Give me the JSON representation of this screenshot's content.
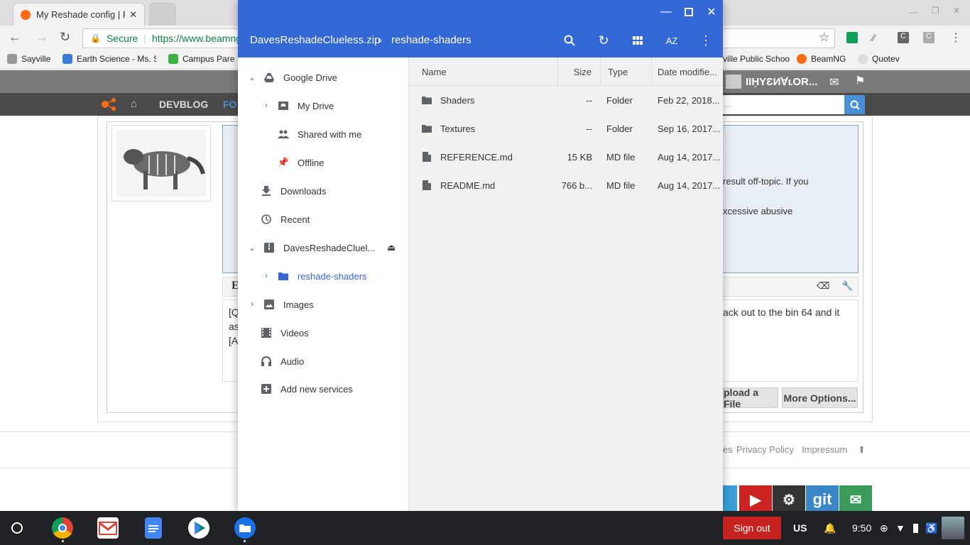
{
  "browser": {
    "tab_title": "My Reshade config | Pag",
    "secure_label": "Secure",
    "url": "https://www.beamng",
    "bookmarks": [
      "Sayville",
      "Earth Science - Ms. S",
      "Campus Pare",
      "ville Public Schoo",
      "BeamNG",
      "Quotev"
    ]
  },
  "website": {
    "nav_devblog": "DEVBLOG",
    "nav_forum_partial": "FO",
    "username": "IIḤYƐИ∀ʟOR...",
    "post_text_1": "result off-topic. If you",
    "post_text_2": "xcessive abusive",
    "reply_text_1": "ack out to the bin 64 and it",
    "reply_left_1": "[Q",
    "reply_left_2": "as",
    "reply_left_3": "[A",
    "reply_left_header": "E",
    "upload_label": "pload a File",
    "more_options": "More Options...",
    "footer_partial": "es",
    "footer_privacy": "Privacy Policy",
    "footer_impressum": "Impressum",
    "social_git": "git"
  },
  "dialog": {
    "breadcrumb": [
      "DavesReshadeClueless.zip",
      "reshade-shaders"
    ],
    "nav": [
      {
        "label": "Google Drive",
        "icon": "google-drive-icon",
        "expanded": true
      },
      {
        "label": "My Drive",
        "icon": "my-drive-icon"
      },
      {
        "label": "Shared with me",
        "icon": "shared-icon"
      },
      {
        "label": "Offline",
        "icon": "pin-icon"
      },
      {
        "label": "Downloads",
        "icon": "download-icon"
      },
      {
        "label": "Recent",
        "icon": "clock-icon"
      },
      {
        "label": "DavesReshadeCluel...",
        "icon": "archive-icon"
      },
      {
        "label": "reshade-shaders",
        "icon": "folder-icon",
        "selected": true
      },
      {
        "label": "Images",
        "icon": "image-icon"
      },
      {
        "label": "Videos",
        "icon": "video-icon"
      },
      {
        "label": "Audio",
        "icon": "audio-icon"
      },
      {
        "label": "Add new services",
        "icon": "add-icon"
      }
    ],
    "columns": {
      "name": "Name",
      "size": "Size",
      "type": "Type",
      "date": "Date modifie..."
    },
    "files": [
      {
        "name": "Shaders",
        "size": "--",
        "type": "Folder",
        "date": "Feb 22, 2018...",
        "icon": "folder-icon"
      },
      {
        "name": "Textures",
        "size": "--",
        "type": "Folder",
        "date": "Sep 16, 2017...",
        "icon": "folder-icon"
      },
      {
        "name": "REFERENCE.md",
        "size": "15 KB",
        "type": "MD file",
        "date": "Aug 14, 2017...",
        "icon": "file-icon"
      },
      {
        "name": "README.md",
        "size": "766 b...",
        "type": "MD file",
        "date": "Aug 14, 2017...",
        "icon": "file-icon"
      }
    ],
    "accent": "#3367d6"
  },
  "shelf": {
    "signout": "Sign out",
    "locale": "US",
    "time": "9:50"
  }
}
